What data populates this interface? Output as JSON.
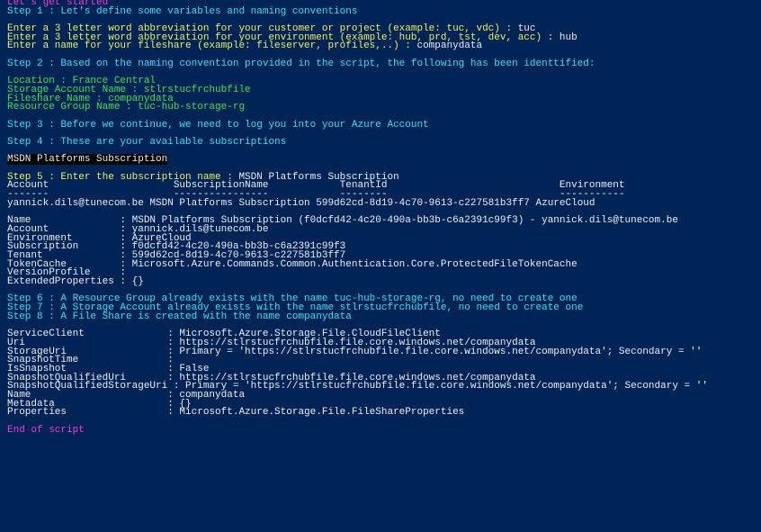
{
  "colors": {
    "background": "#012456",
    "text": "#eeedf0",
    "cyan": "#33e0f2",
    "yellow": "#f0ef5e",
    "green": "#3fe04a",
    "magenta": "#ff36d6"
  },
  "lines": [
    {
      "segments": [
        {
          "text": "Let's get started",
          "color": "magenta"
        }
      ]
    },
    {
      "segments": [
        {
          "text": "Step 1 : Let's define some variables and naming conventions",
          "color": "cyan"
        }
      ]
    },
    {
      "segments": [
        {
          "text": "",
          "color": "white"
        }
      ]
    },
    {
      "segments": [
        {
          "text": "Enter a 3 letter word abbreviation for your customer or project (example: tuc, vdc) : ",
          "color": "yellow"
        },
        {
          "text": "tuc",
          "color": "white"
        }
      ]
    },
    {
      "segments": [
        {
          "text": "Enter a 3 letter word abbreviation for your environment (example: hub, prd, tst, dev, acc) : ",
          "color": "yellow"
        },
        {
          "text": "hub",
          "color": "white"
        }
      ]
    },
    {
      "segments": [
        {
          "text": "Enter a name for your fileshare (example: fileserver, profiles,..) : ",
          "color": "yellow"
        },
        {
          "text": "companydata",
          "color": "white"
        }
      ]
    },
    {
      "segments": [
        {
          "text": "",
          "color": "white"
        }
      ]
    },
    {
      "segments": [
        {
          "text": "Step 2 : Based on the naming convention provided in the script, the following has been identtified:",
          "color": "cyan"
        }
      ]
    },
    {
      "segments": [
        {
          "text": "",
          "color": "white"
        }
      ]
    },
    {
      "segments": [
        {
          "text": "Location : France Central",
          "color": "green"
        }
      ]
    },
    {
      "segments": [
        {
          "text": "Storage Account Name : stlrstucfrchubfile",
          "color": "green"
        }
      ]
    },
    {
      "segments": [
        {
          "text": "Fileshare Name : companydata",
          "color": "green"
        }
      ]
    },
    {
      "segments": [
        {
          "text": "Resource Group Name : tuc-hub-storage-rg",
          "color": "green"
        }
      ]
    },
    {
      "segments": [
        {
          "text": "",
          "color": "white"
        }
      ]
    },
    {
      "segments": [
        {
          "text": "Step 3 : Before we continue, we need to log you into your Azure Account",
          "color": "cyan"
        }
      ]
    },
    {
      "segments": [
        {
          "text": "",
          "color": "white"
        }
      ]
    },
    {
      "segments": [
        {
          "text": "Step 4 : These are your available subscriptions",
          "color": "cyan"
        }
      ]
    },
    {
      "segments": [
        {
          "text": "",
          "color": "white"
        }
      ]
    },
    {
      "segments": [
        {
          "text": "MSDN Platforms Subscription",
          "color": "white",
          "highlight": true
        }
      ]
    },
    {
      "segments": [
        {
          "text": "",
          "color": "white"
        }
      ]
    },
    {
      "segments": [
        {
          "text": "Step 5 : Enter the subscription name : ",
          "color": "yellow"
        },
        {
          "text": "MSDN Platforms Subscription",
          "color": "white"
        }
      ]
    },
    {
      "segments": [
        {
          "text": "Account                     SubscriptionName            TenantId                             Environment",
          "color": "white"
        }
      ]
    },
    {
      "segments": [
        {
          "text": "-------                     ----------------            --------                             -----------",
          "color": "white"
        }
      ]
    },
    {
      "segments": [
        {
          "text": "yannick.dils@tunecom.be MSDN Platforms Subscription 599d62cd-8d19-4c70-9613-c227581b3ff7 AzureCloud",
          "color": "white"
        }
      ]
    },
    {
      "segments": [
        {
          "text": "",
          "color": "white"
        }
      ]
    },
    {
      "segments": [
        {
          "text": "Name               : MSDN Platforms Subscription (f0dcfd42-4c20-490a-bb3b-c6a2391c99f3) - yannick.dils@tunecom.be",
          "color": "white"
        }
      ]
    },
    {
      "segments": [
        {
          "text": "Account            : yannick.dils@tunecom.be",
          "color": "white"
        }
      ]
    },
    {
      "segments": [
        {
          "text": "Environment        : AzureCloud",
          "color": "white"
        }
      ]
    },
    {
      "segments": [
        {
          "text": "Subscription       : f0dcfd42-4c20-490a-bb3b-c6a2391c99f3",
          "color": "white"
        }
      ]
    },
    {
      "segments": [
        {
          "text": "Tenant             : 599d62cd-8d19-4c70-9613-c227581b3ff7",
          "color": "white"
        }
      ]
    },
    {
      "segments": [
        {
          "text": "TokenCache         : Microsoft.Azure.Commands.Common.Authentication.Core.ProtectedFileTokenCache",
          "color": "white"
        }
      ]
    },
    {
      "segments": [
        {
          "text": "VersionProfile     :",
          "color": "white"
        }
      ]
    },
    {
      "segments": [
        {
          "text": "ExtendedProperties : {}",
          "color": "white"
        }
      ]
    },
    {
      "segments": [
        {
          "text": "",
          "color": "white"
        }
      ]
    },
    {
      "segments": [
        {
          "text": "Step 6 : A Resource Group already exists with the name tuc-hub-storage-rg, no need to create one",
          "color": "cyan"
        }
      ]
    },
    {
      "segments": [
        {
          "text": "Step 7 : A Storage Account already exists with the name stlrstucfrchubfile, no need to create one",
          "color": "cyan"
        }
      ]
    },
    {
      "segments": [
        {
          "text": "Step 8 : A File Share is created with the name companydata",
          "color": "cyan"
        }
      ]
    },
    {
      "segments": [
        {
          "text": "",
          "color": "white"
        }
      ]
    },
    {
      "segments": [
        {
          "text": "ServiceClient              : Microsoft.Azure.Storage.File.CloudFileClient",
          "color": "white"
        }
      ]
    },
    {
      "segments": [
        {
          "text": "Uri                        : https://stlrstucfrchubfile.file.core.windows.net/companydata",
          "color": "white"
        }
      ]
    },
    {
      "segments": [
        {
          "text": "StorageUri                 : Primary = 'https://stlrstucfrchubfile.file.core.windows.net/companydata'; Secondary = ''",
          "color": "white"
        }
      ]
    },
    {
      "segments": [
        {
          "text": "SnapshotTime               :",
          "color": "white"
        }
      ]
    },
    {
      "segments": [
        {
          "text": "IsSnapshot                 : False",
          "color": "white"
        }
      ]
    },
    {
      "segments": [
        {
          "text": "SnapshotQualifiedUri       : https://stlrstucfrchubfile.file.core.windows.net/companydata",
          "color": "white"
        }
      ]
    },
    {
      "segments": [
        {
          "text": "SnapshotQualifiedStorageUri : Primary = 'https://stlrstucfrchubfile.file.core.windows.net/companydata'; Secondary = ''",
          "color": "white"
        }
      ]
    },
    {
      "segments": [
        {
          "text": "Name                       : companydata",
          "color": "white"
        }
      ]
    },
    {
      "segments": [
        {
          "text": "Metadata                   : {}",
          "color": "white"
        }
      ]
    },
    {
      "segments": [
        {
          "text": "Properties                 : Microsoft.Azure.Storage.File.FileShareProperties",
          "color": "white"
        }
      ]
    },
    {
      "segments": [
        {
          "text": "",
          "color": "white"
        }
      ]
    },
    {
      "segments": [
        {
          "text": "End of script",
          "color": "magenta"
        }
      ]
    }
  ]
}
